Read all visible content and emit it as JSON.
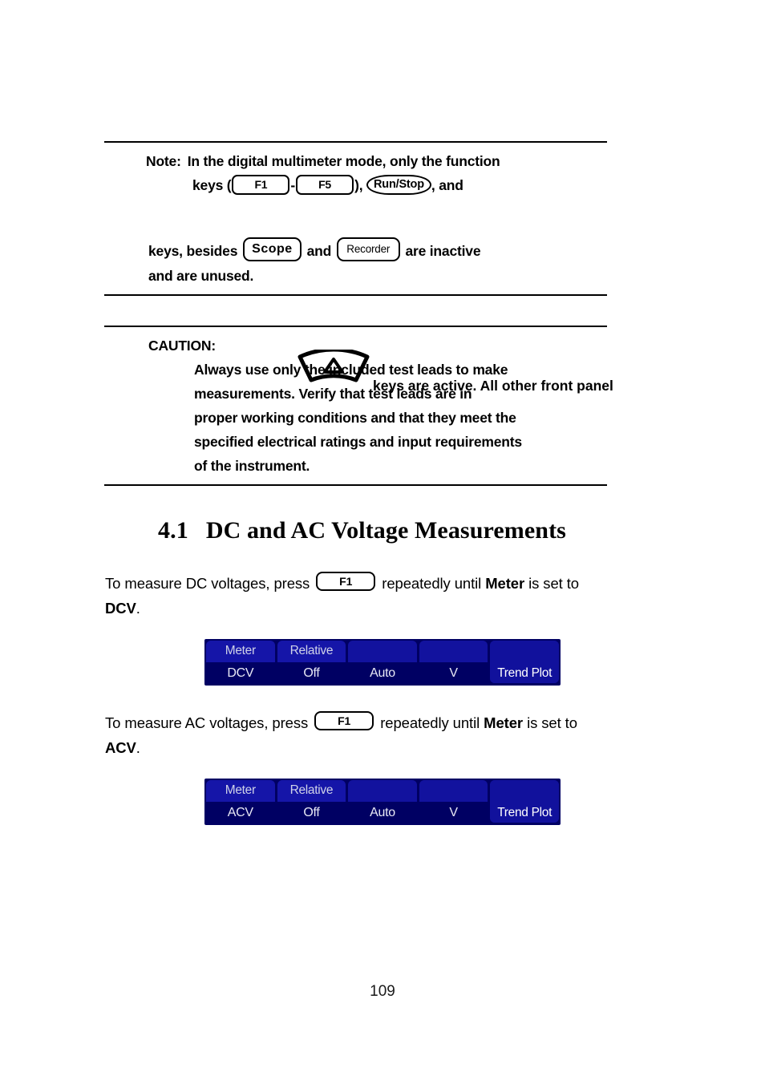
{
  "document": {
    "page_number": "109"
  },
  "note_box": {
    "label": "Note:",
    "line1_text": "In the digital multimeter mode, only the function",
    "line2_prefix": "keys (",
    "key_f1": "F1",
    "line2_dash": "-",
    "key_f5": "F5",
    "line2_mid": "),",
    "key_runstop": "Run/Stop",
    "line2_suffix": ", and",
    "line3_text": "keys are active.  All other front panel",
    "line4_prefix": "keys, besides",
    "key_scope": "Scope",
    "line4_mid": "and",
    "key_recorder": "Recorder",
    "line4_suffix": "are inactive",
    "line5_text": "and are unused.",
    "arc_key_symbol": "Δ"
  },
  "caution_box": {
    "label": "CAUTION:",
    "lines": [
      "Always use only the included test leads to make",
      "measurements.  Verify that test leads are in",
      "proper working conditions and that they meet the",
      "specified electrical ratings and input requirements",
      "of the instrument."
    ]
  },
  "section": {
    "number": "4.1",
    "title": "DC and AC Voltage Measurements"
  },
  "dc_paragraph": {
    "before_key": "To measure DC voltages, press",
    "key_label": "F1",
    "after_key": "repeatedly until",
    "bold_term": "Meter",
    "tail": "is set to",
    "mode_bold": "DCV",
    "period": "."
  },
  "ac_paragraph": {
    "before_key": "To measure AC voltages, press",
    "key_label": "F1",
    "after_key": "repeatedly until",
    "bold_term": "Meter",
    "tail": "is set to",
    "mode_bold": "ACV",
    "period": "."
  },
  "menubar_dcv": {
    "cells": [
      {
        "top": "Meter",
        "bottom": "DCV"
      },
      {
        "top": "Relative",
        "bottom": "Off"
      },
      {
        "top": "",
        "bottom": "Auto"
      },
      {
        "top": "",
        "bottom": "V"
      },
      {
        "top": "",
        "bottom": "Trend Plot"
      }
    ]
  },
  "menubar_acv": {
    "cells": [
      {
        "top": "Meter",
        "bottom": "ACV"
      },
      {
        "top": "Relative",
        "bottom": "Off"
      },
      {
        "top": "",
        "bottom": "Auto"
      },
      {
        "top": "",
        "bottom": "V"
      },
      {
        "top": "",
        "bottom": "Trend Plot"
      }
    ]
  },
  "colors": {
    "menu_highlight_blue": "#1515a8",
    "menu_dark_blue": "#000063",
    "menu_solid_blue": "#11119c",
    "menu_text": "#e8e9f5",
    "rule_black": "#000000"
  }
}
